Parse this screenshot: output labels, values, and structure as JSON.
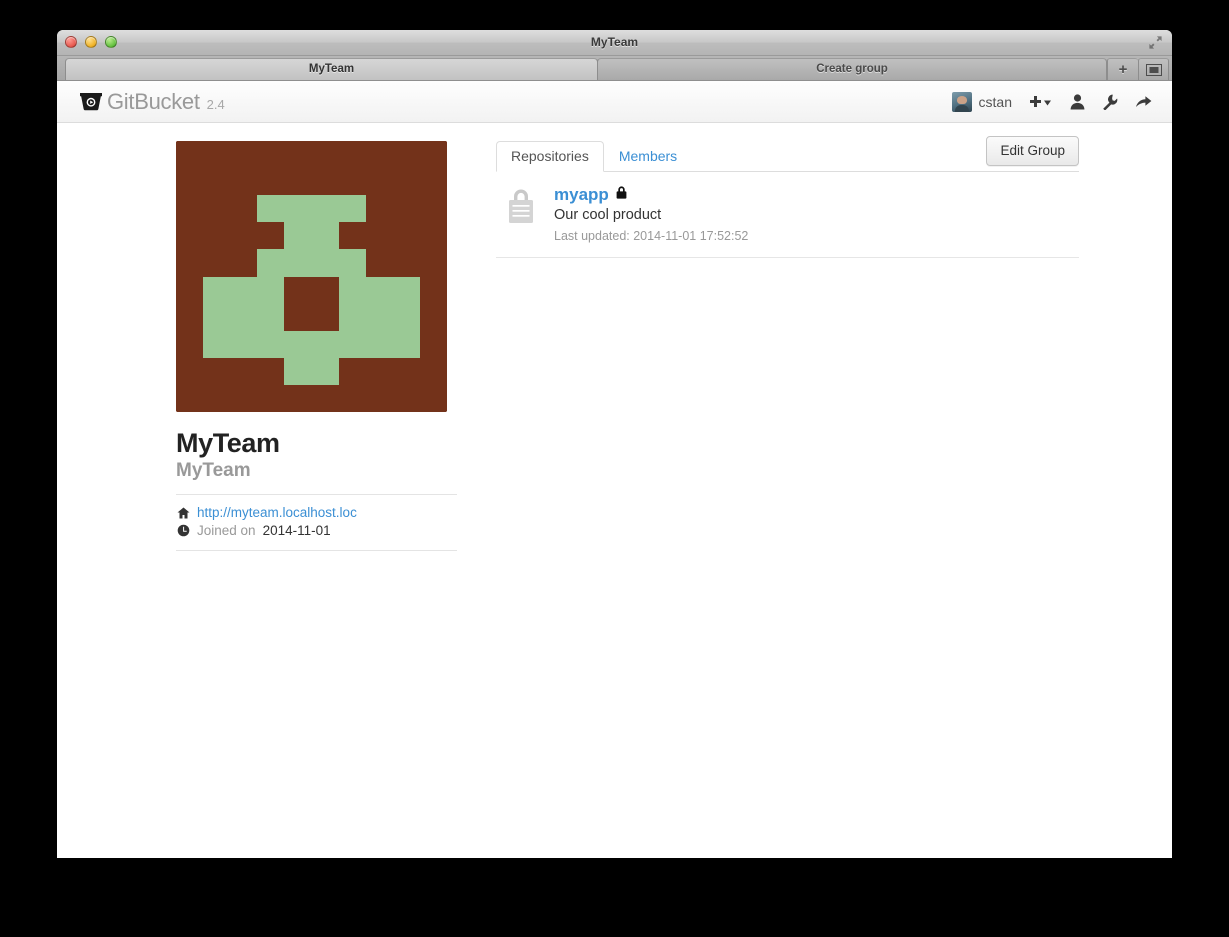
{
  "window": {
    "title": "MyTeam",
    "traffic_lights": [
      "close",
      "minimize",
      "zoom"
    ],
    "expand_icon": "fullscreen-expand-icon"
  },
  "browser_tabs": {
    "tabs": [
      {
        "label": "MyTeam",
        "active": true
      },
      {
        "label": "Create group",
        "active": false
      }
    ],
    "new_tab_label": "+",
    "tab_overview_label": "▯"
  },
  "navbar": {
    "brand": "GitBucket",
    "version": "2.4",
    "logo_icon": "gitbucket-logo-icon",
    "user": {
      "name": "cstan",
      "avatar_icon": "user-avatar"
    },
    "icons": [
      {
        "name": "plus-dropdown-icon",
        "glyph": "+"
      },
      {
        "name": "person-icon",
        "glyph": "person"
      },
      {
        "name": "wrench-icon",
        "glyph": "wrench"
      },
      {
        "name": "sign-out-icon",
        "glyph": "arrow"
      }
    ]
  },
  "group": {
    "name": "MyTeam",
    "full_name": "MyTeam",
    "url": "http://myteam.localhost.loc",
    "url_icon": "home-icon",
    "joined_icon": "clock-icon",
    "joined_label": "Joined on",
    "joined_date": "2014-11-01",
    "identicon": {
      "background_color": "#73321a",
      "foreground_color": "#9ac995",
      "grid": [
        [
          0,
          0,
          0,
          0,
          0,
          0,
          0,
          0,
          0,
          0
        ],
        [
          0,
          0,
          0,
          0,
          0,
          0,
          0,
          0,
          0,
          0
        ],
        [
          0,
          0,
          0,
          1,
          1,
          1,
          1,
          0,
          0,
          0
        ],
        [
          0,
          0,
          0,
          0,
          1,
          1,
          0,
          0,
          0,
          0
        ],
        [
          0,
          0,
          0,
          1,
          1,
          1,
          1,
          0,
          0,
          0
        ],
        [
          0,
          1,
          1,
          1,
          0,
          0,
          1,
          1,
          1,
          0
        ],
        [
          0,
          1,
          1,
          1,
          0,
          0,
          1,
          1,
          1,
          0
        ],
        [
          0,
          1,
          1,
          1,
          1,
          1,
          1,
          1,
          1,
          0
        ],
        [
          0,
          0,
          0,
          0,
          1,
          1,
          0,
          0,
          0,
          0
        ],
        [
          0,
          0,
          0,
          0,
          0,
          0,
          0,
          0,
          0,
          0
        ]
      ]
    }
  },
  "main": {
    "tabs": [
      {
        "label": "Repositories",
        "active": true
      },
      {
        "label": "Members",
        "active": false
      }
    ],
    "edit_group_label": "Edit Group",
    "repositories": [
      {
        "name": "myapp",
        "private": true,
        "repo_icon": "private-repo-lock-icon",
        "badge_icon": "lock-icon",
        "description": "Our cool product",
        "updated_text": "Last updated: 2014-11-01 17:52:52"
      }
    ]
  }
}
